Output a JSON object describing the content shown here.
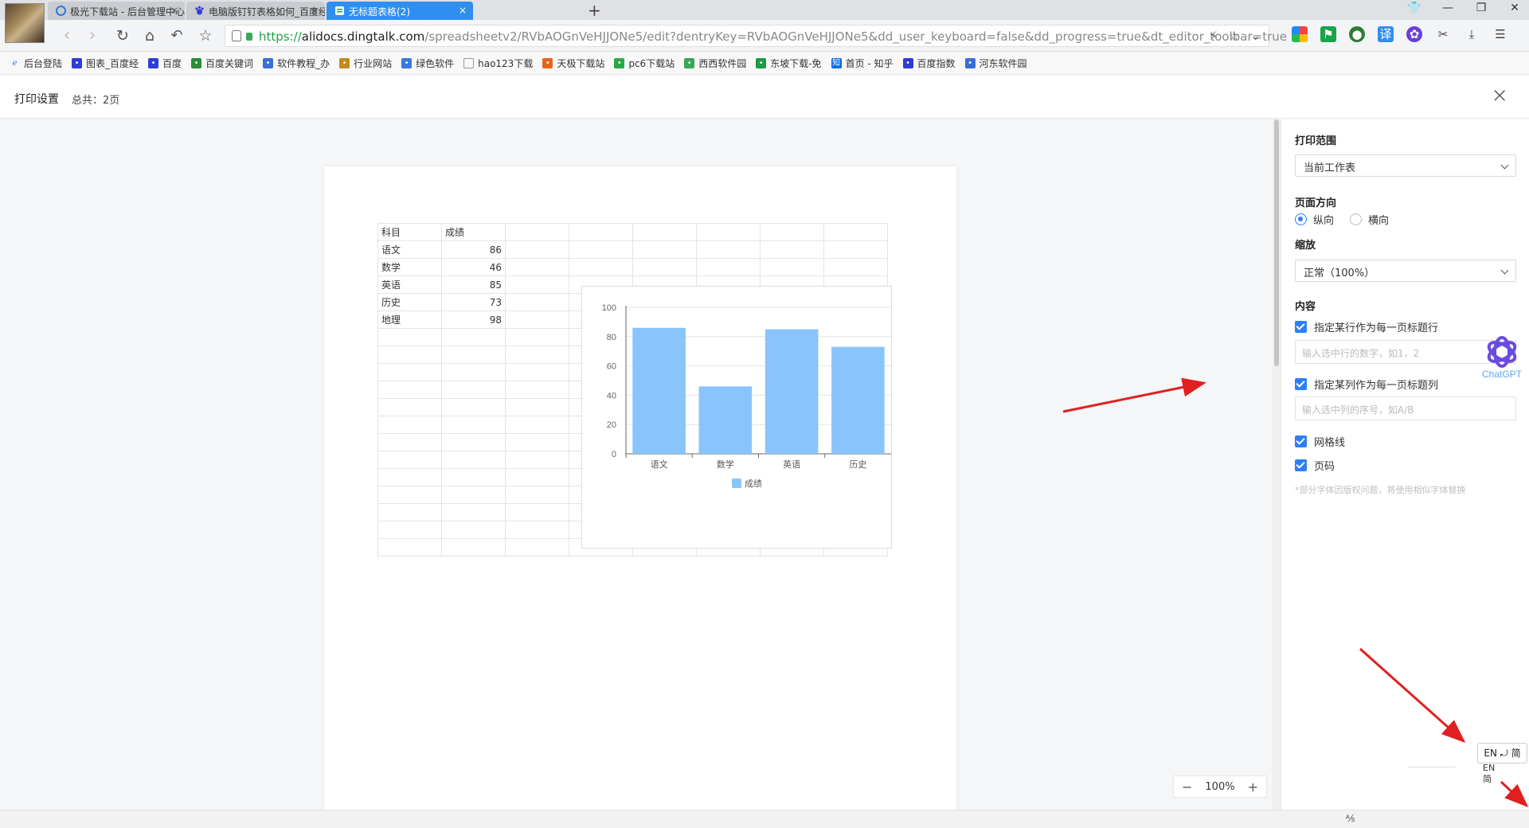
{
  "browser": {
    "tabs": [
      {
        "title": "极光下载站 - 后台管理中心",
        "close": "×"
      },
      {
        "title": "电脑版钉钉表格如何_百度经验",
        "close": "×"
      },
      {
        "title": "无标题表格(2)",
        "close": "×"
      }
    ],
    "new_tab": "+",
    "url": {
      "proto": "https://",
      "host": "alidocs.dingtalk.com",
      "path": "/spreadsheetv2/RVbAOGnVeHJJONe5/edit?dentryKey=RVbAOGnVeHJJONe5&dd_user_keyboard=false&dd_progress=true&dt_editor_toolbar=true"
    },
    "bookmarks": [
      "后台登陆",
      "图表_百度经",
      "百度",
      "百度关键词",
      "软件教程_办",
      "行业网站",
      "绿色软件",
      "hao123下载",
      "天极下载站",
      "pc6下载站",
      "西西软件园",
      "东坡下载-免",
      "首页 - 知乎",
      "百度指数",
      "河东软件园"
    ]
  },
  "print_header": {
    "title": "打印设置",
    "total": "总共：2页",
    "close": "×"
  },
  "sheet": {
    "rows": [
      [
        "科目",
        "成绩"
      ],
      [
        "语文",
        "86"
      ],
      [
        "数学",
        "46"
      ],
      [
        "英语",
        "85"
      ],
      [
        "历史",
        "73"
      ],
      [
        "地理",
        "98"
      ]
    ]
  },
  "chart_data": {
    "type": "bar",
    "categories": [
      "语文",
      "数学",
      "英语",
      "历史"
    ],
    "series": [
      {
        "name": "成绩",
        "values": [
          86,
          46,
          85,
          73
        ],
        "color": "#89c4fb"
      }
    ],
    "ylim": [
      0,
      100
    ],
    "yticks": [
      0,
      20,
      40,
      60,
      80,
      100
    ],
    "grid": true,
    "legend": "bottom"
  },
  "zoom": {
    "minus": "−",
    "value": "100%",
    "plus": "+"
  },
  "panel": {
    "range_label": "打印范围",
    "range_value": "当前工作表",
    "orientation_label": "页面方向",
    "portrait": "纵向",
    "landscape": "横向",
    "orientation_selected": "portrait",
    "scale_label": "缩放",
    "scale_value": "正常（100%）",
    "content_label": "内容",
    "row_title_check": "指定某行作为每一页标题行",
    "row_title_placeholder": "输入选中行的数字，如1，2",
    "col_title_check": "指定某列作为每一页标题列",
    "col_title_placeholder": "输入选中列的序号，如A/B",
    "gridlines": "网格线",
    "page_number": "页码",
    "note": "*部分字体因版权问题，将使用相似字体替换"
  },
  "ime": {
    "box": "EN ⤾ 简",
    "small_1": "EN",
    "small_2": "简"
  },
  "overlay": {
    "logo_text": "ChatGPT"
  },
  "colors": {
    "accent": "#2d7ff9",
    "tab_active": "#2e8ff0",
    "arrow": "#e02020"
  }
}
